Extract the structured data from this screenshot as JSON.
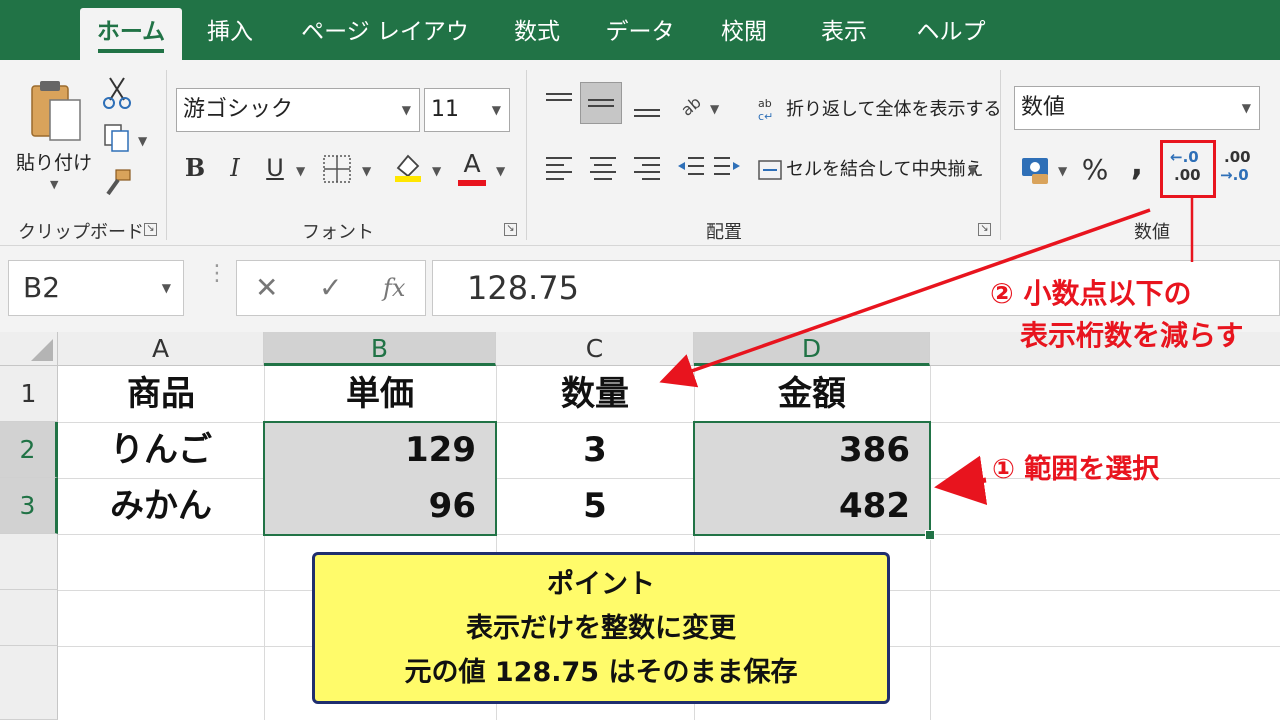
{
  "tabs": [
    {
      "label": "ホーム",
      "active": true
    },
    {
      "label": "挿入"
    },
    {
      "label": "ページ レイアウト"
    },
    {
      "label": "数式"
    },
    {
      "label": "データ"
    },
    {
      "label": "校閲"
    },
    {
      "label": "表示"
    },
    {
      "label": "ヘルプ"
    }
  ],
  "ribbon": {
    "clipboard": {
      "paste_label": "貼り付け",
      "group_label": "クリップボード"
    },
    "font": {
      "font_name": "游ゴシック",
      "font_size": "11",
      "bold": "B",
      "italic": "I",
      "underline": "U",
      "font_color_glyph": "A",
      "group_label": "フォント"
    },
    "alignment": {
      "wrap_text": "折り返して全体を表示する",
      "merge_center": "セルを結合して中央揃え",
      "group_label": "配置"
    },
    "number": {
      "format": "数値",
      "percent": "%",
      "comma": ",",
      "increase_decimal_top": ".00",
      "increase_decimal_bottom": "→.0",
      "decrease_decimal_top": "←.0",
      "decrease_decimal_bottom": ".00",
      "group_label": "数値"
    }
  },
  "formula_bar": {
    "name_box": "B2",
    "cancel": "✕",
    "enter": "✓",
    "fx": "fx",
    "content": "128.75"
  },
  "sheet": {
    "columns": [
      "A",
      "B",
      "C",
      "D"
    ],
    "rows": [
      "1",
      "2",
      "3"
    ],
    "cells": {
      "A1": "商品",
      "B1": "単価",
      "C1": "数量",
      "D1": "金額",
      "A2": "りんご",
      "B2": "129",
      "C2": "3",
      "D2": "386",
      "A3": "みかん",
      "B3": "96",
      "C3": "5",
      "D3": "482"
    }
  },
  "annotations": {
    "step2_line1": "② 小数点以下の",
    "step2_line2": "表示桁数を減らす",
    "step1": "① 範囲を選択",
    "point_title": "ポイント",
    "point_line1": "表示だけを整数に変更",
    "point_line2": "元の値 128.75 はそのまま保存"
  },
  "colors": {
    "excel_green": "#217346",
    "annotation_red": "#e8141e",
    "note_yellow": "#fffb6a",
    "note_border": "#1f2e6e"
  }
}
